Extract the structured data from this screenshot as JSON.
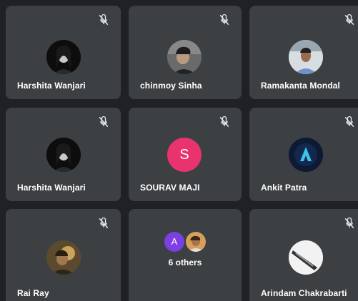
{
  "participants": [
    {
      "name": "Harshita Wanjari",
      "muted_icon": "mic-off-icon",
      "avatar": "photo"
    },
    {
      "name": "chinmoy Sinha",
      "muted_icon": "mic-off-icon",
      "avatar": "photo"
    },
    {
      "name": "Ramakanta Mondal",
      "muted_icon": "mic-off-icon",
      "avatar": "photo"
    },
    {
      "name": "Harshita Wanjari",
      "muted_icon": "mic-off-icon",
      "avatar": "photo"
    },
    {
      "name": "SOURAV MAJI",
      "muted_icon": "mic-off-icon",
      "avatar": "letter",
      "letter": "S",
      "color": "#e8336f"
    },
    {
      "name": "Ankit Patra",
      "muted_icon": "mic-off-icon",
      "avatar": "photo"
    },
    {
      "name": "Rai Ray",
      "muted_icon": "mic-off-icon",
      "avatar": "photo"
    },
    {
      "name": "Arindam Chakrabarti",
      "muted_icon": "mic-off-icon",
      "avatar": "photo"
    }
  ],
  "others": {
    "label": "6 others",
    "letter": "A",
    "letter_color": "#7b3fe4"
  },
  "colors": {
    "background": "#202124",
    "tile": "#3c4043",
    "text": "#ffffff"
  }
}
